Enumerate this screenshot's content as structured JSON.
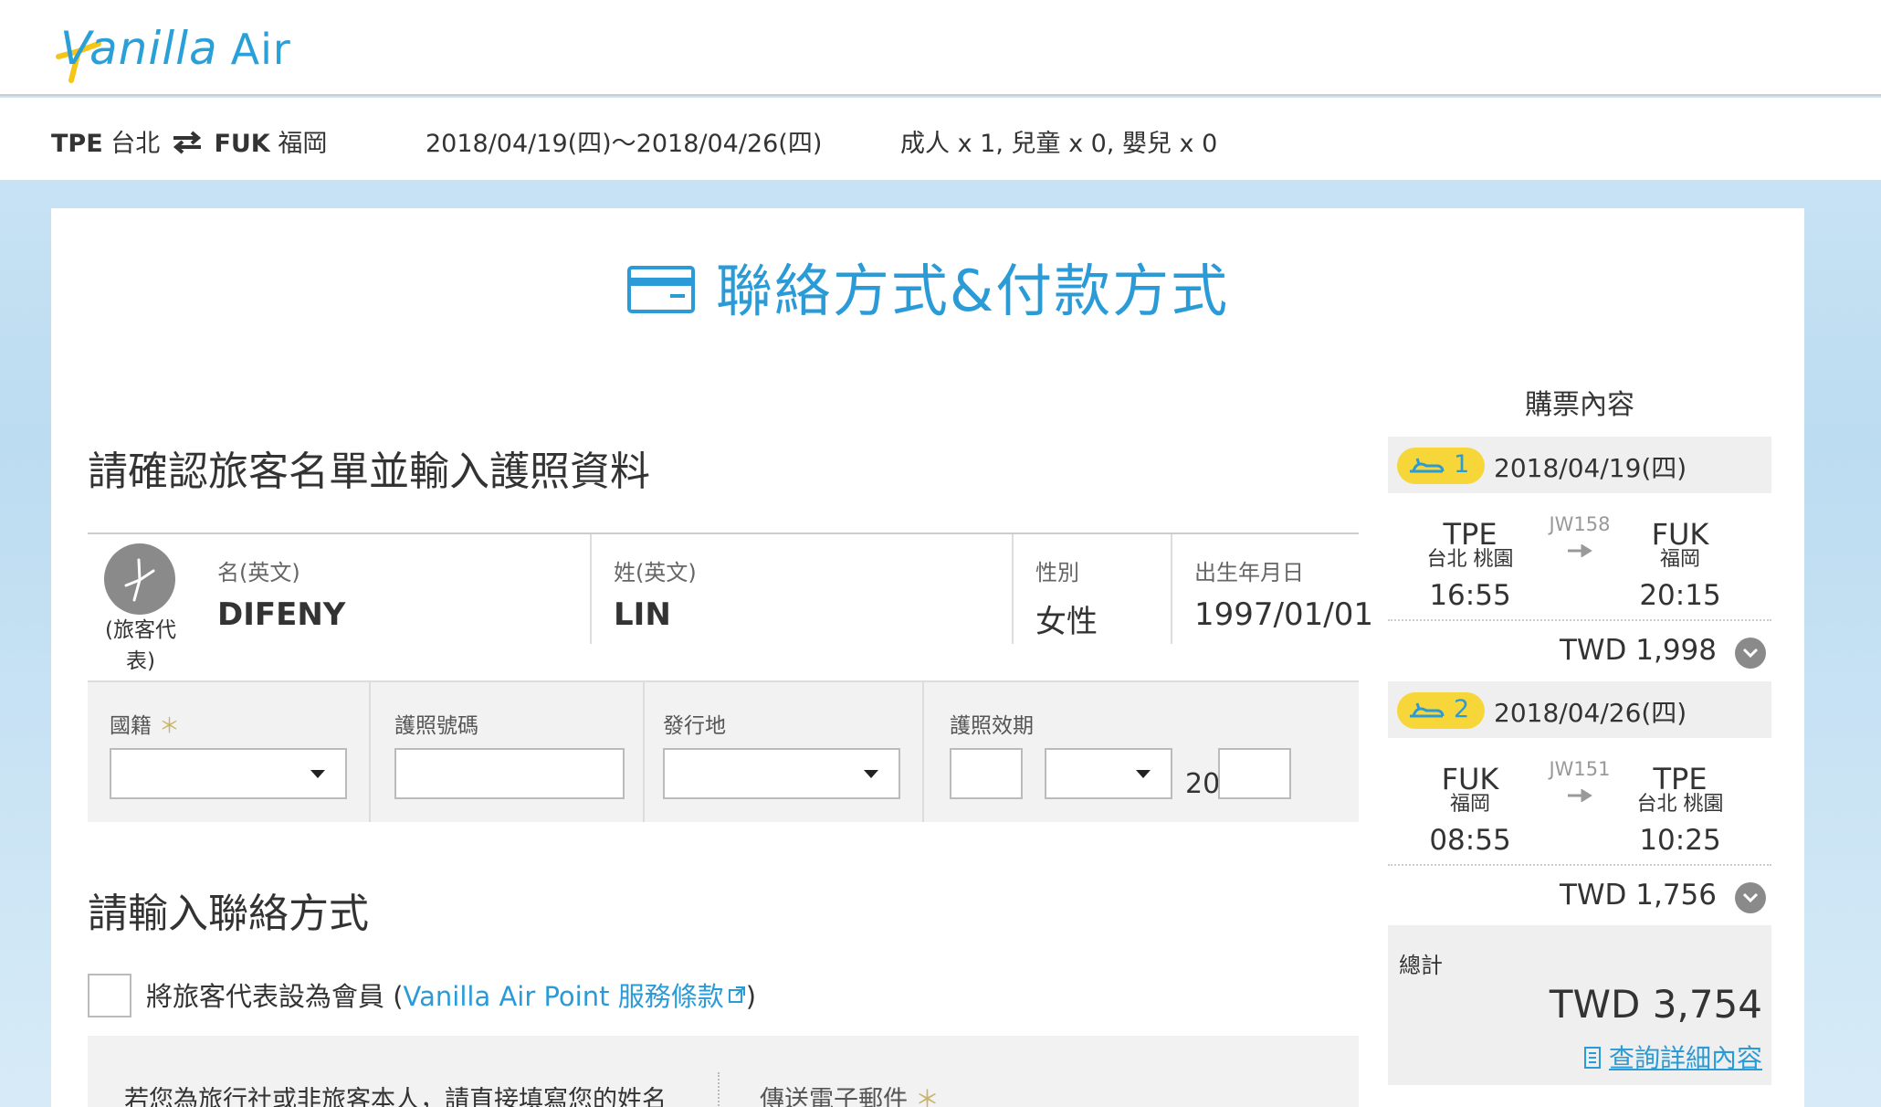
{
  "brand": {
    "logo_text": "Vanilla",
    "logo_text_2": "Air",
    "accent_color": "#2a9bd6",
    "badge_color": "#f7d63a"
  },
  "search_summary": {
    "origin_code": "TPE",
    "origin_city": "台北",
    "dest_code": "FUK",
    "dest_city": "福岡",
    "dates": "2018/04/19(四)～2018/04/26(四)",
    "passengers": "成人 x 1,  兒童 x 0,  嬰兒 x 0"
  },
  "page": {
    "title": "聯絡方式&付款方式"
  },
  "passenger_section": {
    "title": "請確認旅客名單並輸入護照資料",
    "representative_label": "(旅客代表)",
    "first_name_label": "名(英文)",
    "first_name": "DIFENY",
    "last_name_label": "姓(英文)",
    "last_name": "LIN",
    "gender_label": "性別",
    "gender": "女性",
    "dob_label": "出生年月日",
    "dob": "1997/01/01",
    "nationality_label": "國籍",
    "passport_no_label": "護照號碼",
    "issuing_place_label": "發行地",
    "passport_expiry_label": "護照效期",
    "year_prefix": "20",
    "required_mark": "＊"
  },
  "contact_section": {
    "title": "請輸入聯絡方式",
    "member_checkbox_label": "將旅客代表設為會員 (",
    "member_link": "Vanilla Air Point 服務條款",
    "member_checkbox_suffix": ")",
    "agency_note": "若您為旅行社或非旅客本人，請直接填寫您的姓名",
    "send_email_label": "傳送電子郵件",
    "required_mark": "＊"
  },
  "sidebar": {
    "title": "購票內容",
    "legs": [
      {
        "number": "1",
        "date": "2018/04/19(四)",
        "flight_no": "JW158",
        "from_code": "TPE",
        "from_city": "台北 桃園",
        "from_time": "16:55",
        "to_code": "FUK",
        "to_city": "福岡",
        "to_time": "20:15",
        "price": "TWD 1,998"
      },
      {
        "number": "2",
        "date": "2018/04/26(四)",
        "flight_no": "JW151",
        "from_code": "FUK",
        "from_city": "福岡",
        "from_time": "08:55",
        "to_code": "TPE",
        "to_city": "台北 桃園",
        "to_time": "10:25",
        "price": "TWD 1,756"
      }
    ],
    "total_label": "總計",
    "total_amount": "TWD 3,754",
    "details_link": "查詢詳細內容"
  }
}
